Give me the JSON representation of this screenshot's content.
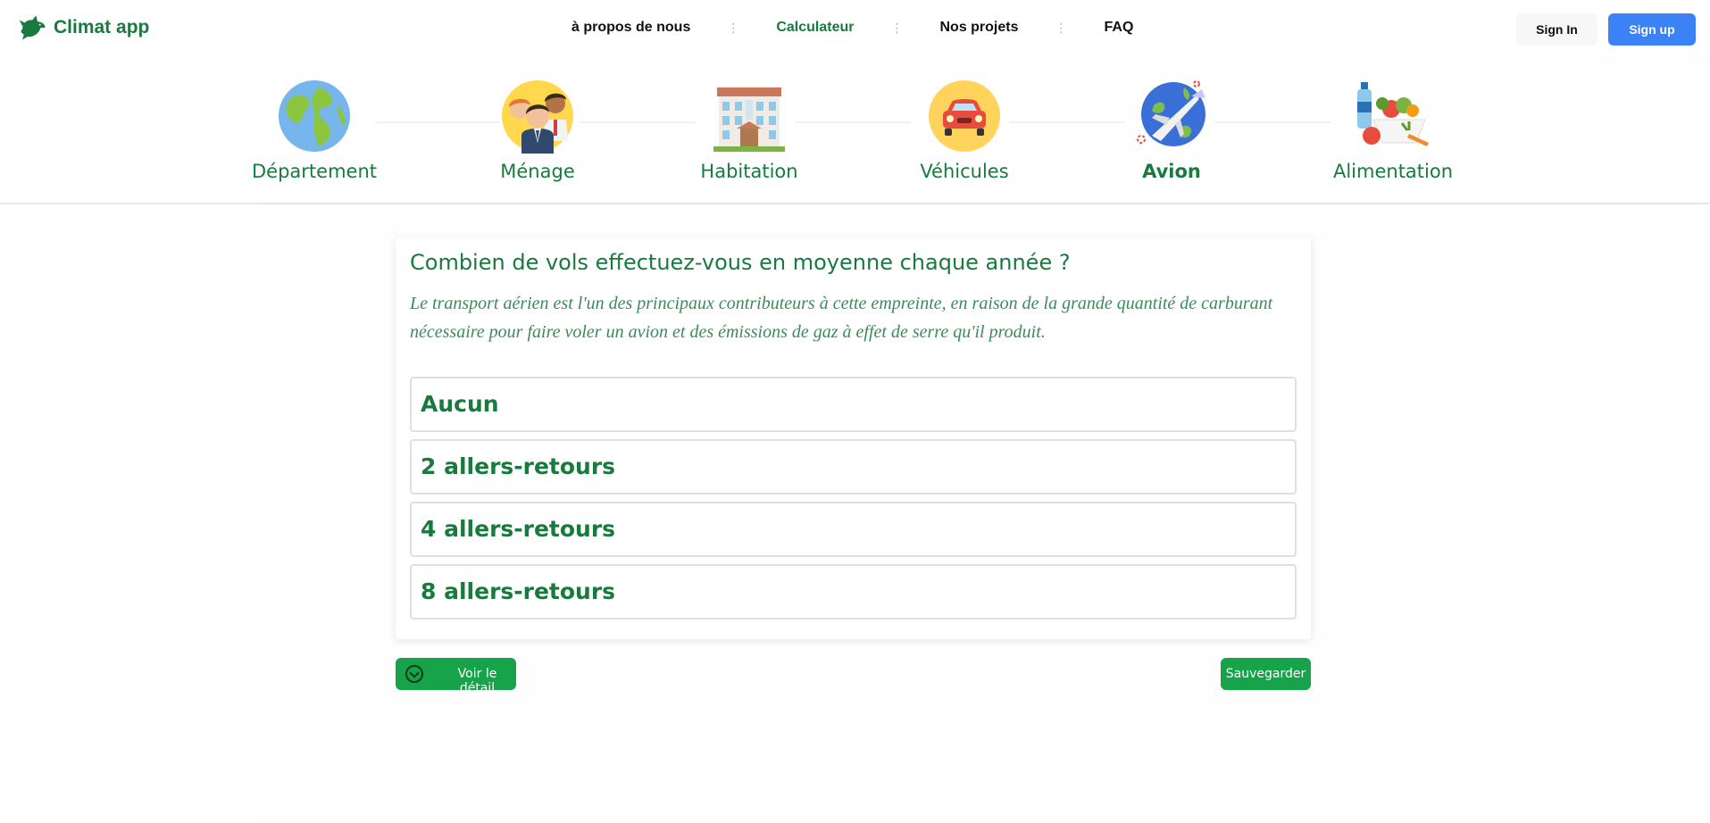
{
  "brand": {
    "name": "Climat app",
    "icon": "dove-icon",
    "color": "#197a3e"
  },
  "nav": {
    "links": [
      {
        "label": "à propos de nous",
        "active": false
      },
      {
        "label": "Calculateur",
        "active": true
      },
      {
        "label": "Nos projets",
        "active": false
      },
      {
        "label": "FAQ",
        "active": false
      }
    ],
    "separator": "⋮"
  },
  "auth": {
    "signin_label": "Sign In",
    "signup_label": "Sign up",
    "signup_color": "#3b82f6"
  },
  "steps": [
    {
      "label": "Département",
      "icon": "globe-icon",
      "active": false
    },
    {
      "label": "Ménage",
      "icon": "family-icon",
      "active": false
    },
    {
      "label": "Habitation",
      "icon": "building-icon",
      "active": false
    },
    {
      "label": "Véhicules",
      "icon": "car-icon",
      "active": false
    },
    {
      "label": "Avion",
      "icon": "airplane-icon",
      "active": true
    },
    {
      "label": "Alimentation",
      "icon": "food-icon",
      "active": false
    }
  ],
  "question": {
    "title": "Combien de vols effectuez-vous en moyenne chaque année ?",
    "description": "Le transport aérien est l'un des principaux contributeurs à cette empreinte, en raison de la grande quantité de carburant nécessaire pour faire voler un avion et des émissions de gaz à effet de serre qu'il produit.",
    "options": [
      "Aucun",
      "2 allers-retours",
      "4 allers-retours",
      "8 allers-retours"
    ]
  },
  "actions": {
    "detail_label": "Voir le détail",
    "save_label": "Sauvegarder",
    "button_color": "#16a34a"
  }
}
